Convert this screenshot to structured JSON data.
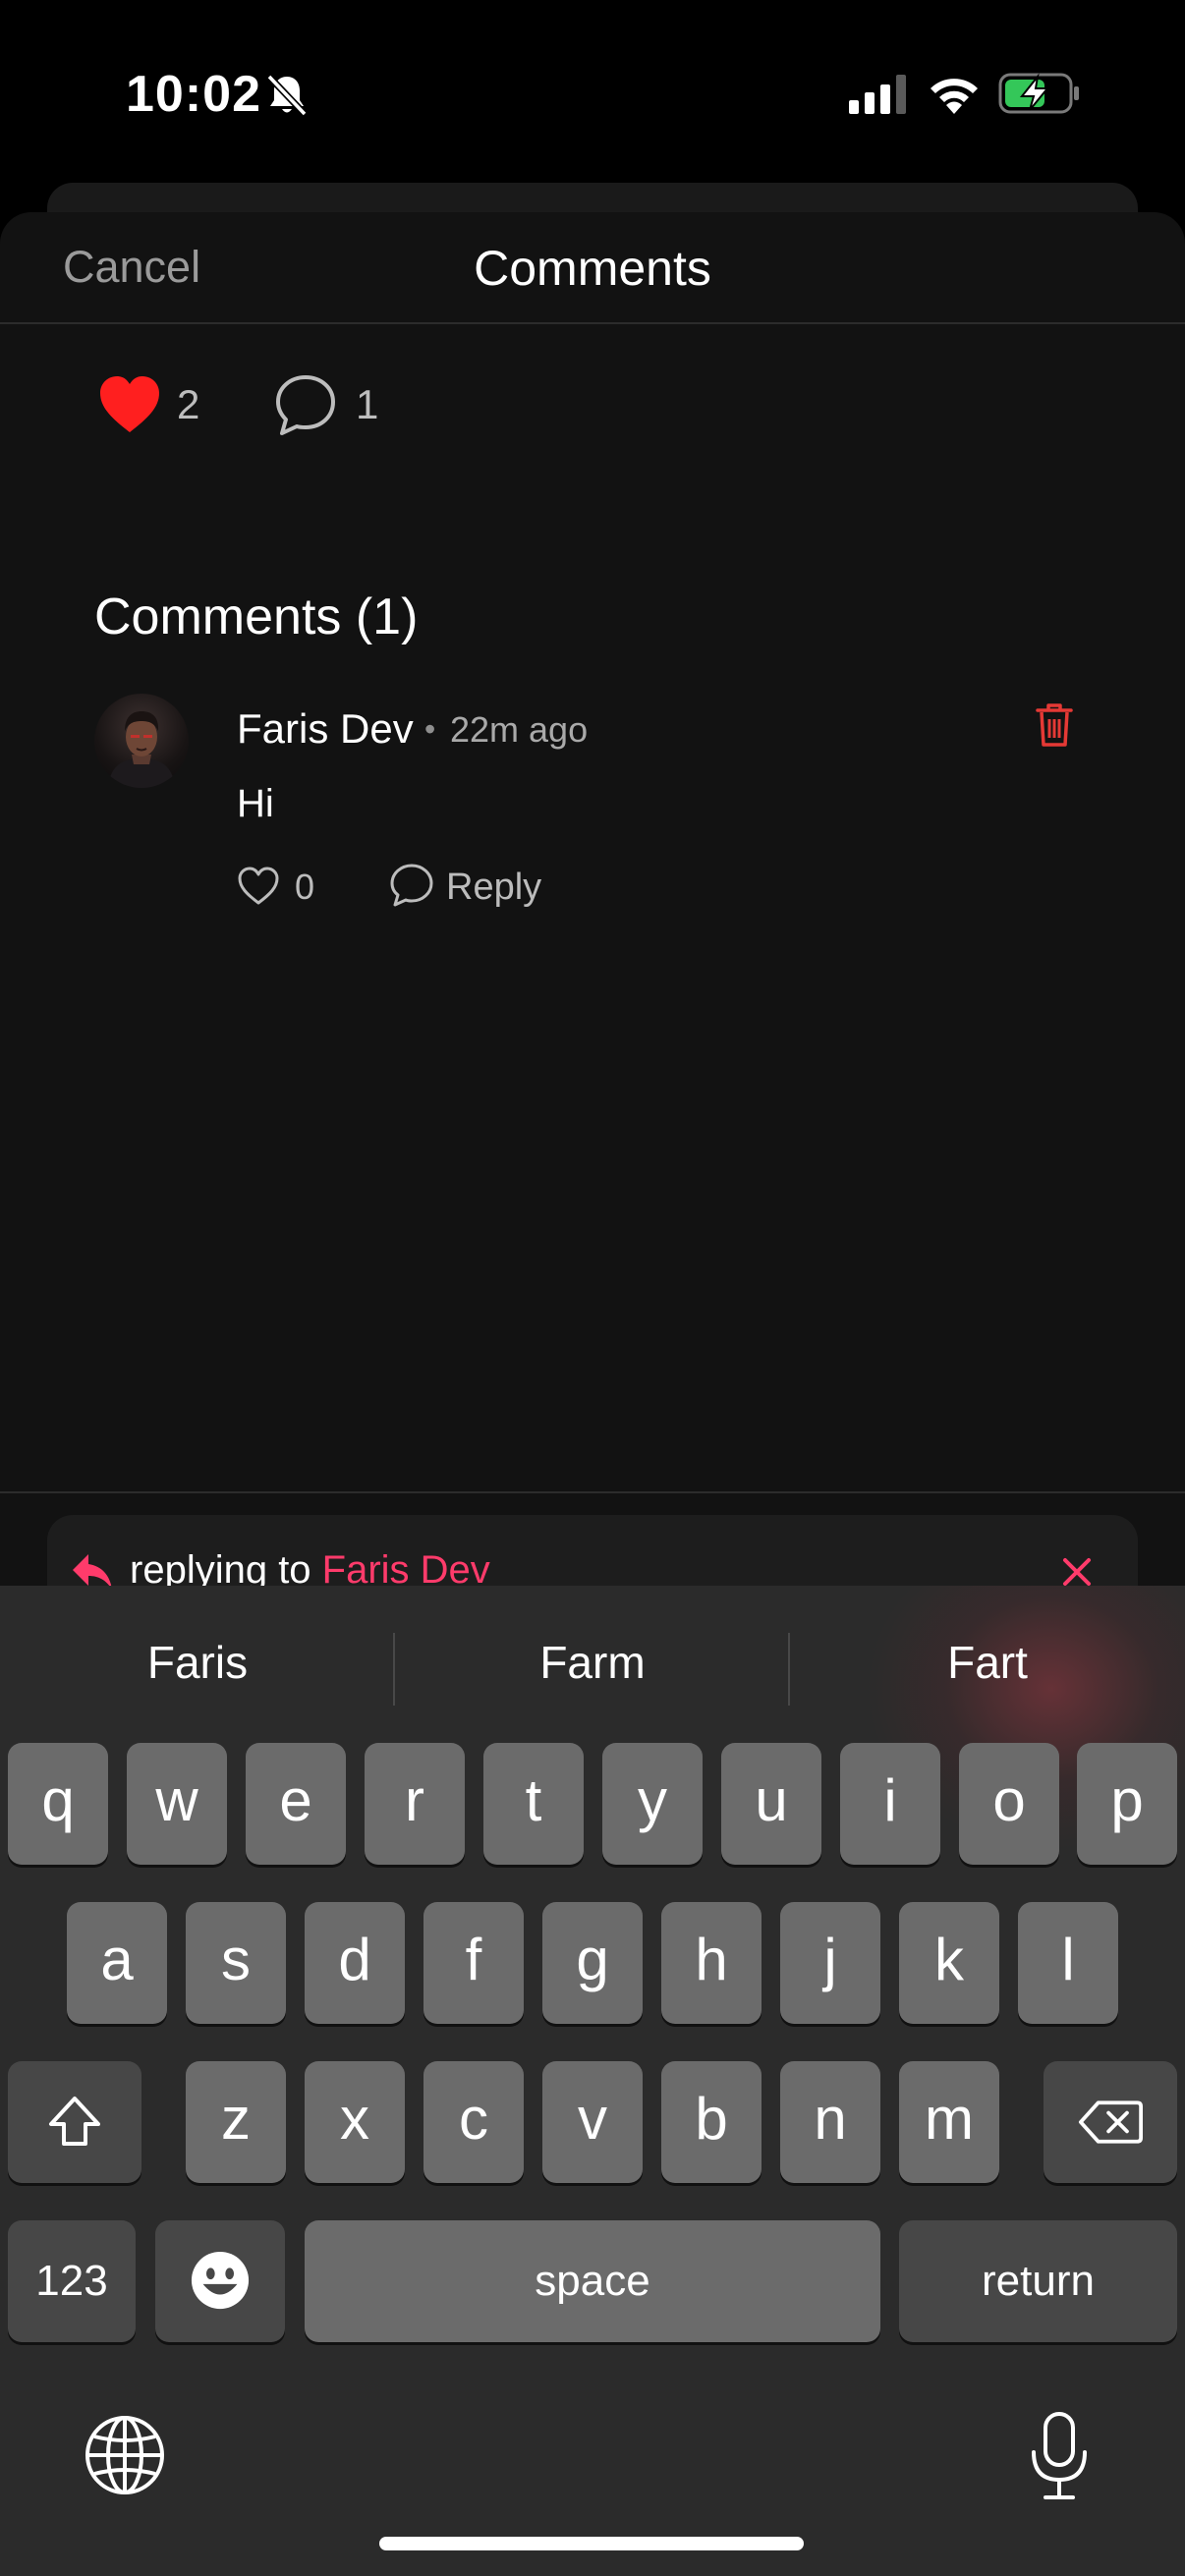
{
  "status_bar": {
    "time": "10:02",
    "icons": [
      "bell-slash-icon",
      "cellular-signal-icon",
      "wifi-icon",
      "battery-charging-icon"
    ]
  },
  "header": {
    "cancel_label": "Cancel",
    "title": "Comments"
  },
  "post_stats": {
    "likes": "2",
    "comments": "1"
  },
  "comments_section": {
    "title": "Comments (1)",
    "items": [
      {
        "author": "Faris Dev",
        "separator": "•",
        "time_ago": "22m ago",
        "text": "Hi",
        "likes": "0",
        "reply_label": "Reply"
      }
    ]
  },
  "reply_bar": {
    "prefix": "replying to ",
    "target": "Faris Dev"
  },
  "keyboard": {
    "suggestions": [
      "Faris",
      "Farm",
      "Fart"
    ],
    "row1": [
      "q",
      "w",
      "e",
      "r",
      "t",
      "y",
      "u",
      "i",
      "o",
      "p"
    ],
    "row2": [
      "a",
      "s",
      "d",
      "f",
      "g",
      "h",
      "j",
      "k",
      "l"
    ],
    "row3": [
      "z",
      "x",
      "c",
      "v",
      "b",
      "n",
      "m"
    ],
    "numbers_label": "123",
    "space_label": "space",
    "return_label": "return"
  },
  "colors": {
    "accent": "#ff3b6b",
    "like_red": "#ff1f1f",
    "delete_red": "#e53935",
    "background": "#121212"
  }
}
